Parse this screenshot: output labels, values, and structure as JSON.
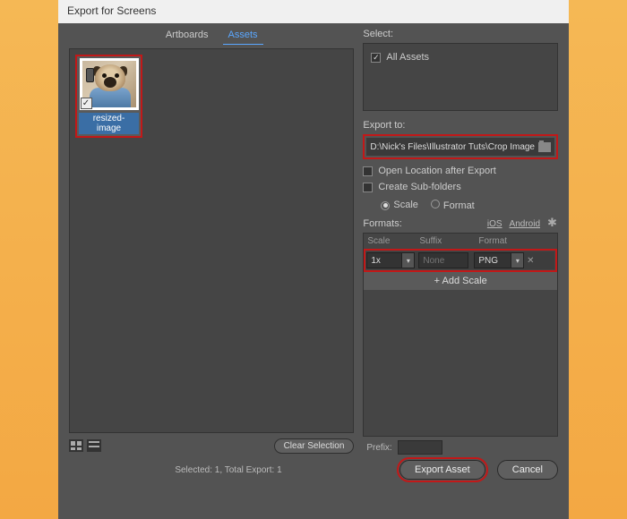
{
  "dialog": {
    "title": "Export for Screens"
  },
  "tabs": {
    "artboards": "Artboards",
    "assets": "Assets"
  },
  "asset": {
    "label": "resized-image"
  },
  "toolbar": {
    "clear_selection": "Clear Selection"
  },
  "select": {
    "heading": "Select:",
    "all_assets": "All Assets"
  },
  "export_to": {
    "heading": "Export to:",
    "path": "D:\\Nick's Files\\Illustrator Tuts\\Crop Image",
    "open_location": "Open Location after Export",
    "create_subfolders": "Create Sub-folders",
    "scale_opt": "Scale",
    "format_opt": "Format"
  },
  "formats": {
    "heading": "Formats:",
    "ios": "iOS",
    "android": "Android",
    "col_scale": "Scale",
    "col_suffix": "Suffix",
    "col_format": "Format",
    "scale_val": "1x",
    "suffix_val": "None",
    "format_val": "PNG",
    "add_scale": "+  Add Scale"
  },
  "prefix": {
    "label": "Prefix:"
  },
  "status": "Selected: 1, Total Export: 1",
  "buttons": {
    "export": "Export Asset",
    "cancel": "Cancel"
  }
}
